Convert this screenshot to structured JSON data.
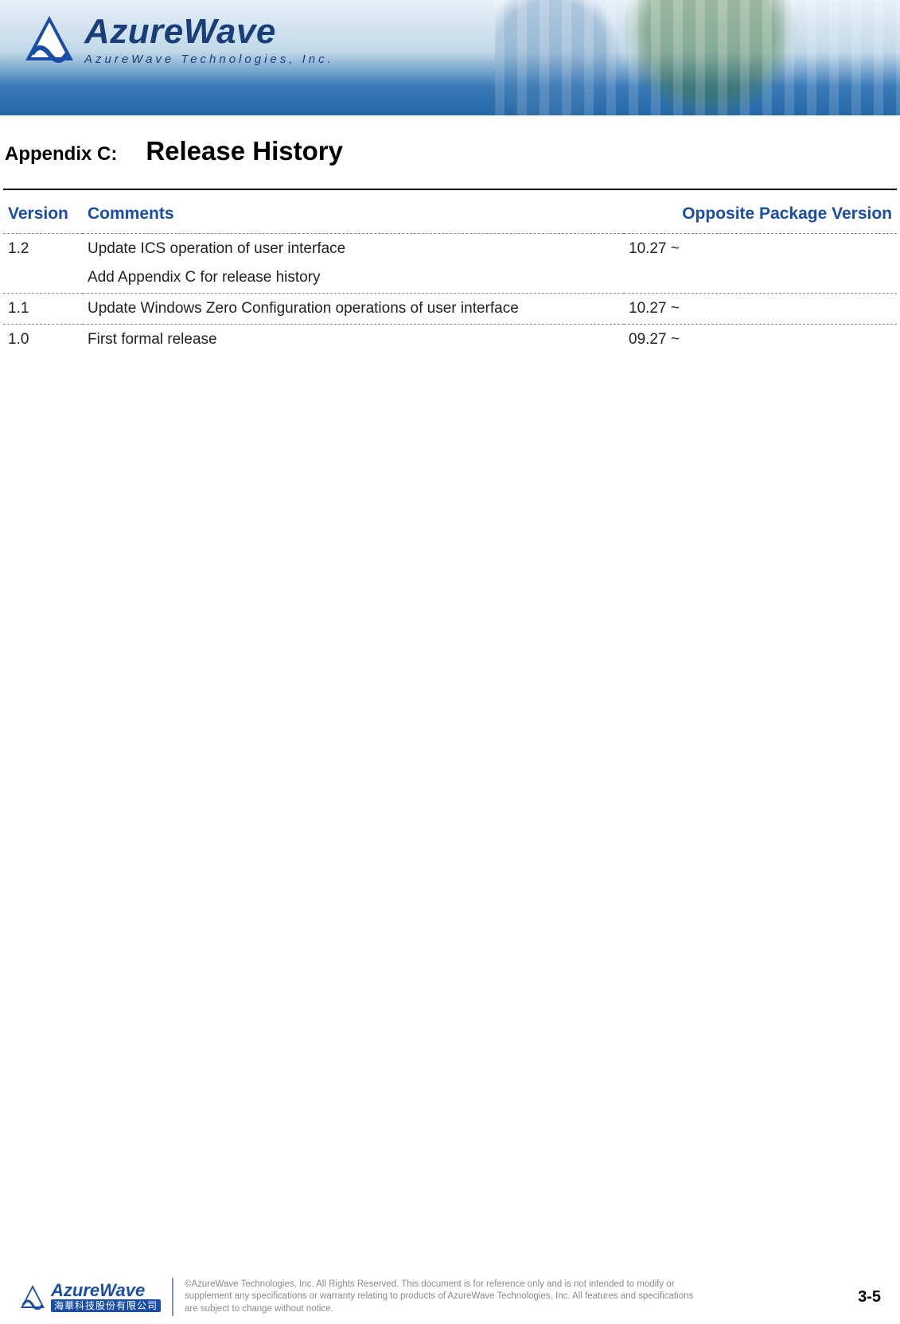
{
  "header": {
    "brand": "AzureWave",
    "tagline": "AzureWave  Technologies,  Inc."
  },
  "title": {
    "appendix_label": "Appendix C:",
    "heading": "Release History"
  },
  "table": {
    "headers": {
      "version": "Version",
      "comments": "Comments",
      "opposite": "Opposite Package Version"
    },
    "rows": [
      {
        "version": "1.2",
        "comment": "Update ICS operation of user interface",
        "opposite": "10.27 ~"
      },
      {
        "version": "",
        "comment": "Add Appendix C for release history",
        "opposite": ""
      },
      {
        "version": "1.1",
        "comment": "Update Windows Zero Configuration operations of user interface",
        "opposite": "10.27 ~"
      },
      {
        "version": "1.0",
        "comment": "First formal release",
        "opposite": "09.27 ~"
      }
    ]
  },
  "footer": {
    "brand": "AzureWave",
    "brand_cn": "海華科技股份有限公司",
    "copyright": "©AzureWave Technologies, Inc. All Rights Reserved. This document is for reference only and is not intended to modify or supplement any specifications or warranty relating to products of AzureWave Technologies, Inc.  All features and specifications are subject to change without notice.",
    "page_number": "3-5"
  }
}
